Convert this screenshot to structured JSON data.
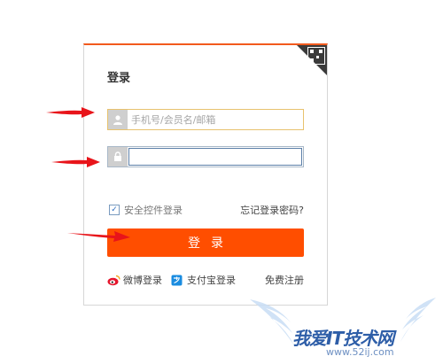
{
  "login": {
    "title": "登录",
    "username_placeholder": "手机号/会员名/邮箱",
    "password_value": "",
    "safe_control_label": "安全控件登录",
    "forgot_label": "忘记登录密码?",
    "submit_label": "登录",
    "weibo_label": "微博登录",
    "alipay_label": "支付宝登录",
    "register_label": "免费注册"
  },
  "watermark": {
    "text": "我爱IT技术网",
    "url": "www.52ij.com"
  },
  "colors": {
    "accent": "#ff4e00",
    "annotation_arrow": "#e8141a"
  },
  "icons": [
    "qr-code-icon",
    "user-icon",
    "lock-icon",
    "checkbox-checked-icon",
    "weibo-icon",
    "alipay-icon"
  ]
}
